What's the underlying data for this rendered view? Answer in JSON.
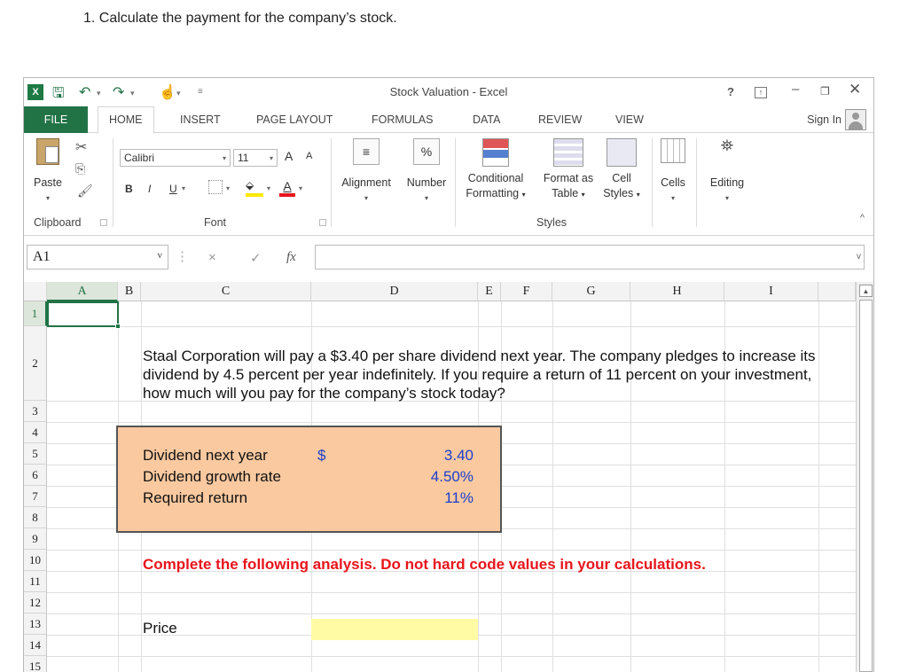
{
  "question": "1. Calculate the payment for the company’s stock.",
  "window": {
    "title": "Stock Valuation - Excel",
    "help": "?",
    "sign_in": "Sign In"
  },
  "tabs": [
    "FILE",
    "HOME",
    "INSERT",
    "PAGE LAYOUT",
    "FORMULAS",
    "DATA",
    "REVIEW",
    "VIEW"
  ],
  "ribbon": {
    "paste": "Paste",
    "font_name": "Calibri",
    "font_size": "11",
    "bold": "B",
    "italic": "I",
    "underline": "U",
    "grow_font": "A",
    "shrink_font": "A",
    "font_color": "A",
    "percent": "%",
    "alignment": "Alignment",
    "number": "Number",
    "conditional_1": "Conditional",
    "conditional_2": "Formatting",
    "format_as_1": "Format as",
    "format_as_2": "Table",
    "cell_1": "Cell",
    "cell_2": "Styles",
    "cells": "Cells",
    "editing": "Editing",
    "groups": {
      "clipboard": "Clipboard",
      "font": "Font",
      "styles": "Styles"
    }
  },
  "formula_bar": {
    "name_box": "A1",
    "fx": "fx",
    "cancel": "×",
    "enter": "✓",
    "content": ""
  },
  "columns": [
    "A",
    "B",
    "C",
    "D",
    "E",
    "F",
    "G",
    "H",
    "I"
  ],
  "rows": [
    "1",
    "2",
    "3",
    "4",
    "5",
    "6",
    "7",
    "8",
    "9",
    "10",
    "11",
    "12",
    "13",
    "14",
    "15"
  ],
  "sheet": {
    "problem": "Staal Corporation will pay a $3.40 per share dividend next year. The company pledges to increase its dividend by 4.5 percent per year indefinitely. If you require a return of 11 percent on your investment, how much will you pay for the company’s stock today?",
    "inputs": [
      {
        "label": "Dividend next year",
        "value": "3.40"
      },
      {
        "label": "Dividend growth rate",
        "value": "4.50%"
      },
      {
        "label": "Required return",
        "value": "11%"
      }
    ],
    "currency": "$",
    "instruction": "Complete the following analysis. Do not hard code values in your calculations.",
    "price_label": "Price",
    "price_value": ""
  },
  "colors": {
    "excel_green": "#217346",
    "input_box": "#fac9a0",
    "input_blue": "#1a3fcc",
    "instruction_red": "#e8141c",
    "answer_cell": "#fffba4"
  }
}
